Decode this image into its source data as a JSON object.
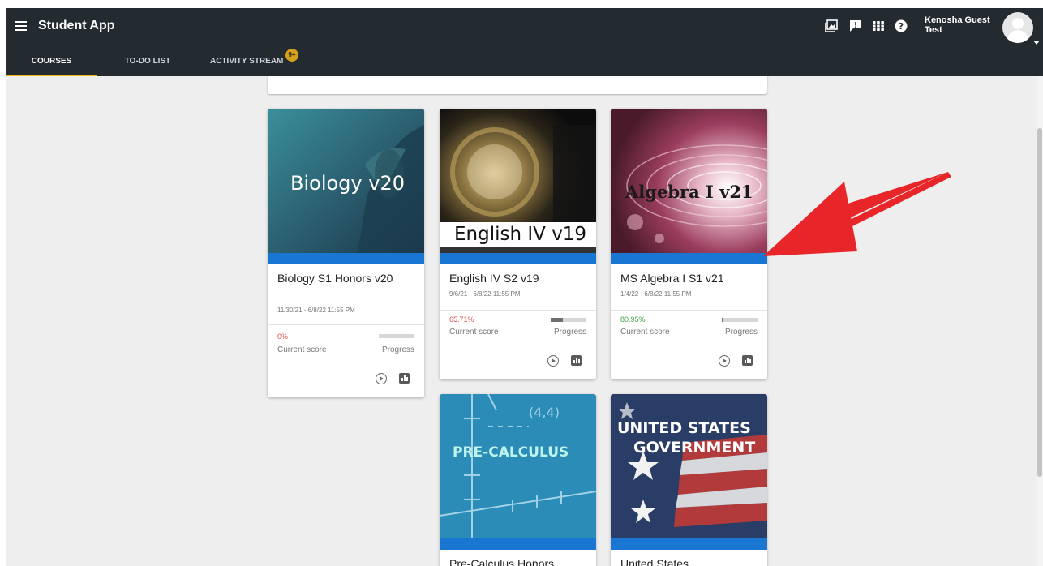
{
  "app": {
    "title": "Student App"
  },
  "tabs": [
    {
      "label": "COURSES",
      "active": true
    },
    {
      "label": "TO-DO LIST",
      "active": false
    },
    {
      "label": "ACTIVITY STREAM",
      "active": false,
      "badge": "9+"
    }
  ],
  "toolbar_icons": [
    "gallery-icon",
    "feedback-icon",
    "apps-grid-icon",
    "help-icon"
  ],
  "user": {
    "name_line1": "Kenosha Guest",
    "name_line2": "Test"
  },
  "colors": {
    "appbar": "#232a30",
    "accent_tab": "#f3b41a",
    "card_bar": "#1976d2",
    "score_red": "#d9534f",
    "score_green": "#43a047"
  },
  "courses": [
    {
      "image_title": "Biology v20",
      "title": "Biology S1 Honors v20",
      "dates": "11/30/21 - 6/8/22 11:55 PM",
      "score": "0%",
      "score_label": "Current score",
      "progress_label": "Progress",
      "progress": 0.0
    },
    {
      "image_title": "English IV v19",
      "title": "English IV S2 v19",
      "dates": "9/6/21 - 6/8/22 11:55 PM",
      "score": "65.71%",
      "score_label": "Current score",
      "progress_label": "Progress",
      "progress": 0.35
    },
    {
      "image_title": "Algebra I v21",
      "title": "MS Algebra I S1 v21",
      "dates": "1/4/22 - 6/8/22 11:55 PM",
      "score": "80.95%",
      "score_label": "Current score",
      "progress_label": "Progress",
      "progress": 0.04
    },
    {
      "image_title": "PRE-CALCULUS",
      "title": "Pre-Calculus Honors"
    },
    {
      "image_title_line1": "UNITED STATES",
      "image_title_line2": "GOVERNMENT",
      "title": "United States"
    }
  ]
}
